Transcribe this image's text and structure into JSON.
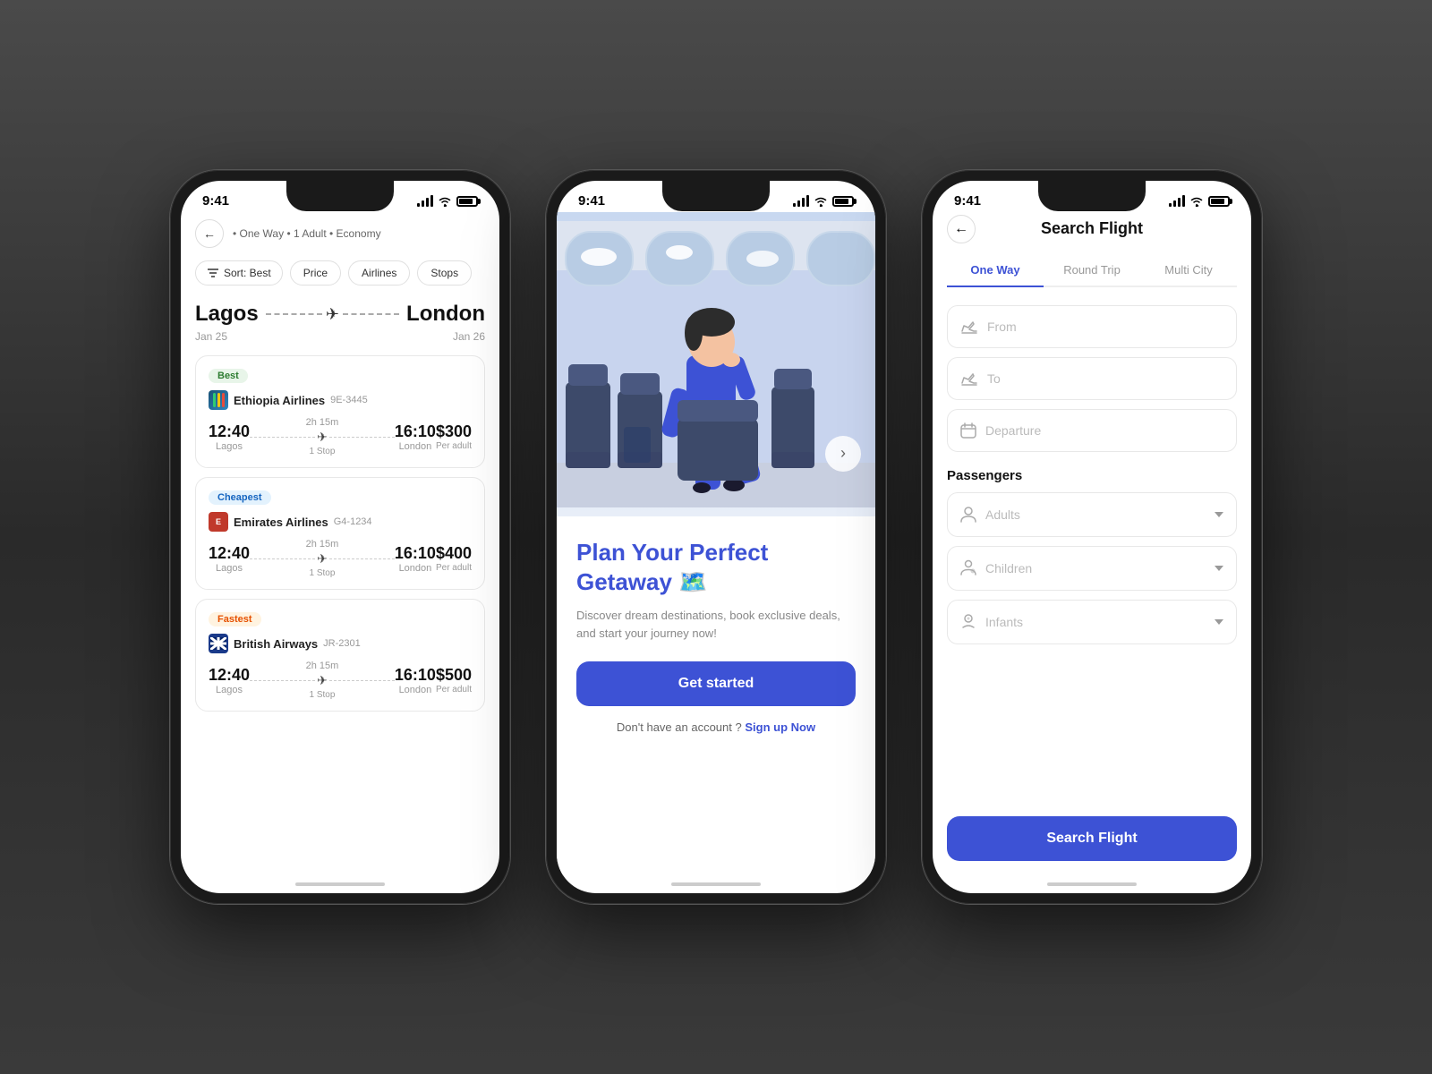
{
  "background": "#3a3a3a",
  "phones": [
    {
      "id": "phone1",
      "statusBar": {
        "time": "9:41"
      },
      "header": {
        "backBtn": "←",
        "tripInfo": "• One Way • 1 Adult • Economy"
      },
      "filters": {
        "sort": "Sort: Best",
        "buttons": [
          "Price",
          "Airlines",
          "Stops"
        ]
      },
      "route": {
        "from": "Lagos",
        "to": "London",
        "dateFrom": "Jan 25",
        "dateTo": "Jan 26"
      },
      "flights": [
        {
          "badge": "Best",
          "badgeType": "best",
          "airline": "Ethiopia Airlines",
          "code": "9E-3445",
          "depTime": "12:40",
          "depCity": "Lagos",
          "duration": "2h 15m",
          "stops": "1 Stop",
          "arrTime": "16:10",
          "arrCity": "London",
          "price": "$300",
          "priceLabel": "Per adult"
        },
        {
          "badge": "Cheapest",
          "badgeType": "cheapest",
          "airline": "Emirates Airlines",
          "code": "G4-1234",
          "depTime": "12:40",
          "depCity": "Lagos",
          "duration": "2h 15m",
          "stops": "1 Stop",
          "arrTime": "16:10",
          "arrCity": "London",
          "price": "$400",
          "priceLabel": "Per adult"
        },
        {
          "badge": "Fastest",
          "badgeType": "fastest",
          "airline": "British Airways",
          "code": "JR-2301",
          "depTime": "12:40",
          "depCity": "Lagos",
          "duration": "2h 15m",
          "stops": "1 Stop",
          "arrTime": "16:10",
          "arrCity": "London",
          "price": "$500",
          "priceLabel": "Per adult"
        }
      ]
    },
    {
      "id": "phone2",
      "statusBar": {
        "time": "9:41"
      },
      "hero": {
        "altText": "Woman sitting in airplane cabin"
      },
      "tagline": "Plan Your Perfect Getaway 🗺️",
      "description": "Discover dream destinations, book exclusive deals, and start your journey now!",
      "ctaButton": "Get started",
      "signupText": "Don't have an account ?",
      "signupLink": "Sign up Now"
    },
    {
      "id": "phone3",
      "statusBar": {
        "time": "9:41"
      },
      "title": "Search Flight",
      "backBtn": "←",
      "tabs": [
        {
          "label": "One Way",
          "active": true
        },
        {
          "label": "Round Trip",
          "active": false
        },
        {
          "label": "Multi City",
          "active": false
        }
      ],
      "fields": {
        "from": "From",
        "to": "To",
        "departure": "Departure"
      },
      "passengersLabel": "Passengers",
      "dropdowns": [
        {
          "icon": "👤",
          "placeholder": "Adults"
        },
        {
          "icon": "👦",
          "placeholder": "Children"
        },
        {
          "icon": "👶",
          "placeholder": "Infants"
        }
      ],
      "searchBtn": "Search Flight"
    }
  ]
}
